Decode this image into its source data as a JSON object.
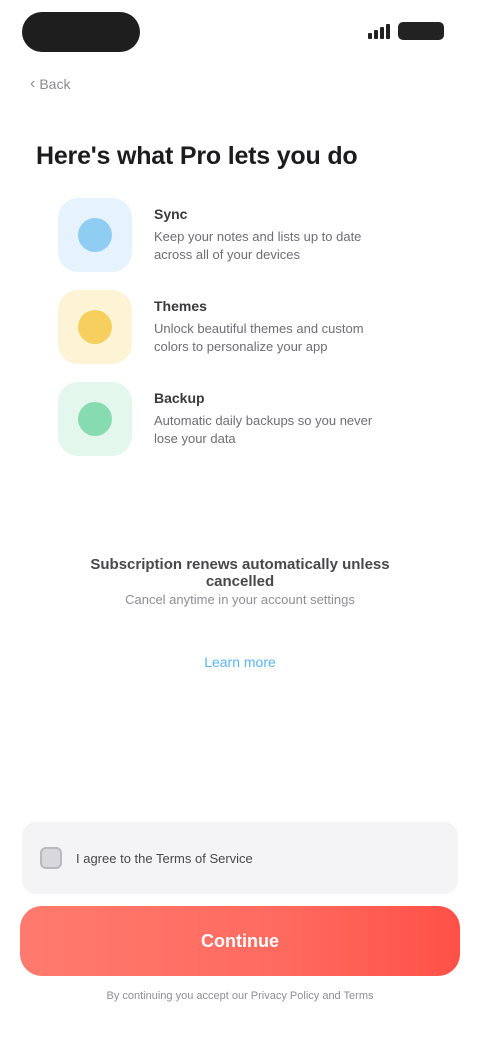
{
  "nav": {
    "back_label": "Back"
  },
  "headline": "Here's what Pro lets you do",
  "features": [
    {
      "icon": "cloud-sync-icon",
      "color": "#8fcdf3",
      "bg": "#e6f3fc",
      "title": "Sync",
      "description": "Keep your notes and lists up to date across all of your devices"
    },
    {
      "icon": "star-icon",
      "color": "#f6cf5e",
      "bg": "#fdf4d6",
      "title": "Themes",
      "description": "Unlock beautiful themes and custom colors to personalize your app"
    },
    {
      "icon": "shield-icon",
      "color": "#86dcb0",
      "bg": "#e3f7ec",
      "title": "Backup",
      "description": "Automatic daily backups so you never lose your data"
    }
  ],
  "info": {
    "text": "Subscription renews automatically unless cancelled",
    "subtext": "Cancel anytime in your account settings",
    "learn_more": "Learn more"
  },
  "agree": {
    "label": "I agree to the Terms of Service"
  },
  "cta": {
    "label": "Continue"
  },
  "legal": "By continuing you accept our Privacy Policy and Terms"
}
